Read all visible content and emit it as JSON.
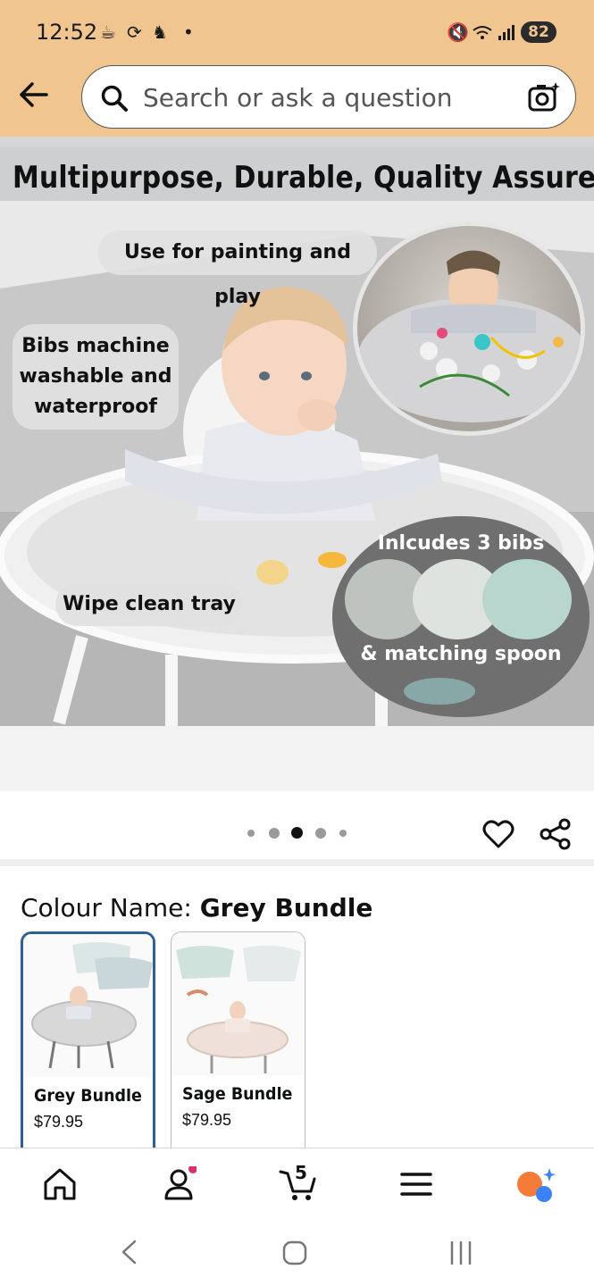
{
  "status_bar": {
    "time": "12:52",
    "battery": "82"
  },
  "search": {
    "placeholder": "Search or ask a question"
  },
  "hero": {
    "banner": "Multipurpose, Durable, Quality Assured",
    "callouts": {
      "painting": "Use for painting and play",
      "washable_line1": "Bibs machine",
      "washable_line2": "washable and",
      "washable_line3": "waterproof",
      "tray": "Wipe clean tray",
      "bibs": "Inlcudes 3 bibs",
      "spoon": "& matching spoon"
    },
    "carousel": {
      "count": 5,
      "active_index": 2
    }
  },
  "colour": {
    "label": "Colour Name:",
    "selected": "Grey Bundle"
  },
  "variants": [
    {
      "name": "Grey Bundle",
      "price": "$79.95",
      "selected": true
    },
    {
      "name": "Sage Bundle",
      "price": "$79.95",
      "selected": false
    }
  ],
  "bottom_nav": {
    "cart_count": "5",
    "icons": [
      "home-icon",
      "account-icon",
      "cart-icon",
      "menu-icon",
      "rufus-assistant-icon"
    ]
  },
  "colors": {
    "header_bg": "#f0c590",
    "selected_border": "#2f5f98",
    "notification_dot": "#d5336a",
    "assistant_orange": "#f47b38",
    "assistant_blue": "#3b82f6"
  }
}
